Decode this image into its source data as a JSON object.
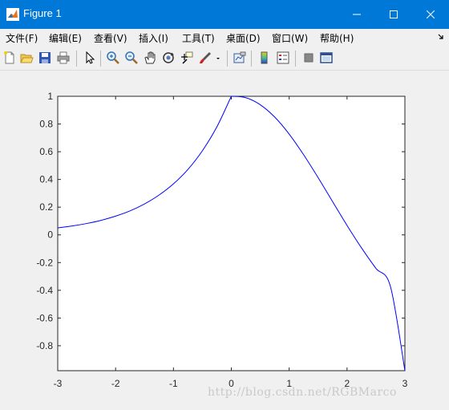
{
  "window": {
    "title": "Figure 1"
  },
  "menu": [
    {
      "label": "文件(F)"
    },
    {
      "label": "编辑(E)"
    },
    {
      "label": "查看(V)"
    },
    {
      "label": "插入(I)"
    },
    {
      "label": "工具(T)"
    },
    {
      "label": "桌面(D)"
    },
    {
      "label": "窗口(W)"
    },
    {
      "label": "帮助(H)"
    }
  ],
  "toolbar_icons": [
    "new-figure-icon",
    "open-file-icon",
    "save-icon",
    "print-icon",
    "pointer-icon",
    "zoom-in-icon",
    "zoom-out-icon",
    "pan-hand-icon",
    "rotate-3d-icon",
    "data-cursor-icon",
    "brush-icon",
    "link-plot-icon",
    "colorbar-icon",
    "legend-icon",
    "hide-plot-tools-icon",
    "show-plot-tools-icon"
  ],
  "chart_data": {
    "type": "line",
    "title": "",
    "xlabel": "",
    "ylabel": "",
    "xlim": [
      -3,
      3
    ],
    "ylim": [
      -0.98,
      1
    ],
    "xticks": [
      -3,
      -2,
      -1,
      0,
      1,
      2,
      3
    ],
    "xtick_labels": [
      "-3",
      "-2",
      "-1",
      "0",
      "1",
      "2",
      "3"
    ],
    "yticks": [
      1,
      0.8,
      0.6,
      0.4,
      0.2,
      0,
      -0.2,
      -0.4,
      -0.6,
      -0.8
    ],
    "ytick_labels": [
      "1",
      "0.8",
      "0.6",
      "0.4",
      "0.2",
      "0",
      "-0.2",
      "-0.4",
      "-0.6",
      "-0.8"
    ],
    "grid": false,
    "series": [
      {
        "color": "#0000ff",
        "x": [
          -3,
          -2.75,
          -2.5,
          -2.25,
          -2,
          -1.75,
          -1.5,
          -1.25,
          -1,
          -0.75,
          -0.5,
          -0.25,
          0,
          0.25,
          0.5,
          0.75,
          1,
          1.25,
          1.5,
          1.75,
          2,
          2.25,
          2.5,
          2.75,
          3
        ],
        "y": [
          0.05,
          0.064,
          0.082,
          0.105,
          0.135,
          0.173,
          0.223,
          0.287,
          0.368,
          0.472,
          0.607,
          0.779,
          1.0,
          0.99,
          0.939,
          0.85,
          0.727,
          0.578,
          0.413,
          0.24,
          0.068,
          -0.094,
          -0.242,
          -0.372,
          -0.98
        ]
      }
    ]
  },
  "watermark": "http://blog.csdn.net/RGBMarco"
}
